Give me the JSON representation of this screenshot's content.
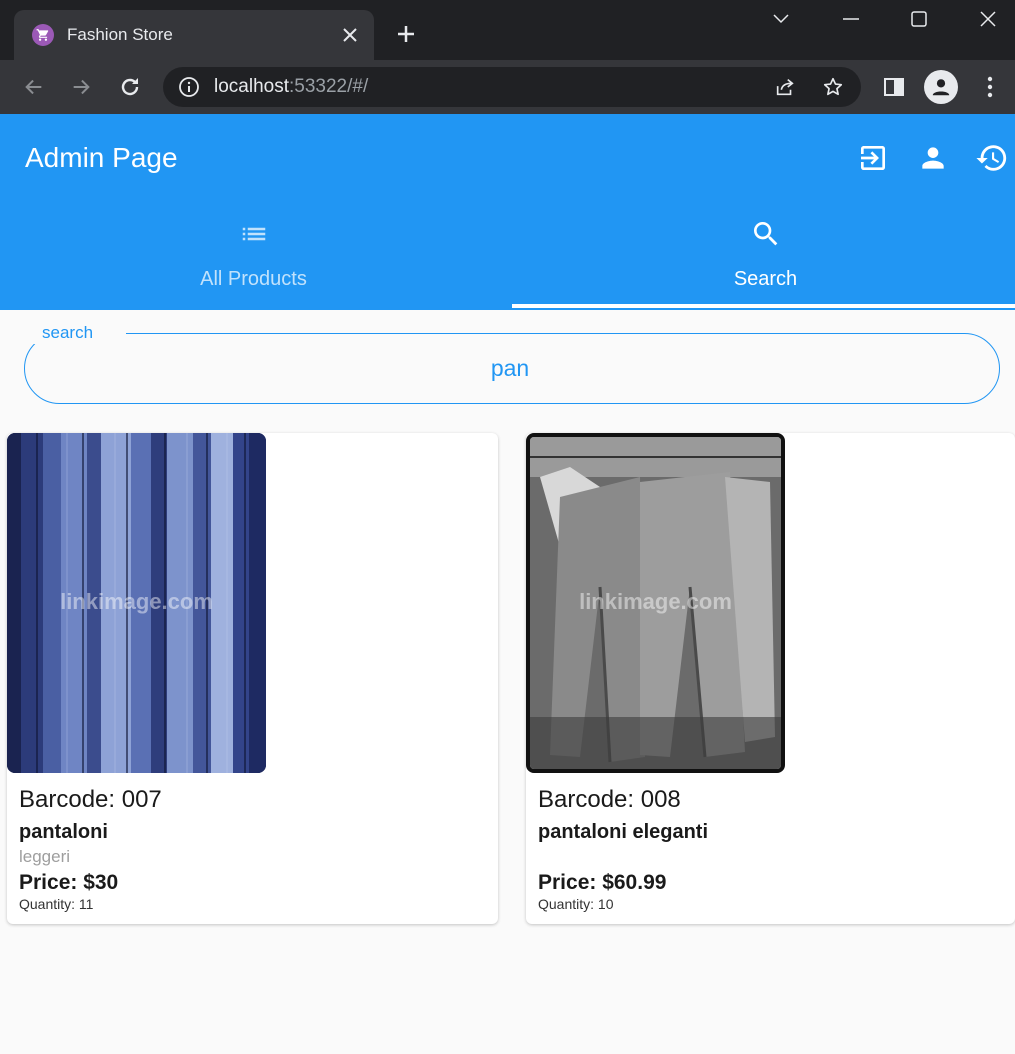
{
  "browser": {
    "tab_title": "Fashion Store",
    "url_host": "localhost",
    "url_rest": ":53322/#/"
  },
  "app": {
    "title": "Admin Page",
    "actions": [
      "logout-icon",
      "person-icon",
      "history-icon"
    ],
    "accent_color": "#2196f3"
  },
  "tabs": [
    {
      "label": "All Products",
      "icon": "list-icon",
      "active": false
    },
    {
      "label": "Search",
      "icon": "search-icon",
      "active": true
    }
  ],
  "search": {
    "label": "search",
    "value": "pan"
  },
  "products": [
    {
      "barcode": "Barcode: 007",
      "name": "pantaloni",
      "description": "leggeri",
      "price": "Price: $30",
      "quantity": "Quantity: 11",
      "watermark": "linkimage.com"
    },
    {
      "barcode": "Barcode: 008",
      "name": "pantaloni eleganti",
      "description": "",
      "price": "Price: $60.99",
      "quantity": "Quantity: 10",
      "watermark": "linkimage.com"
    }
  ]
}
